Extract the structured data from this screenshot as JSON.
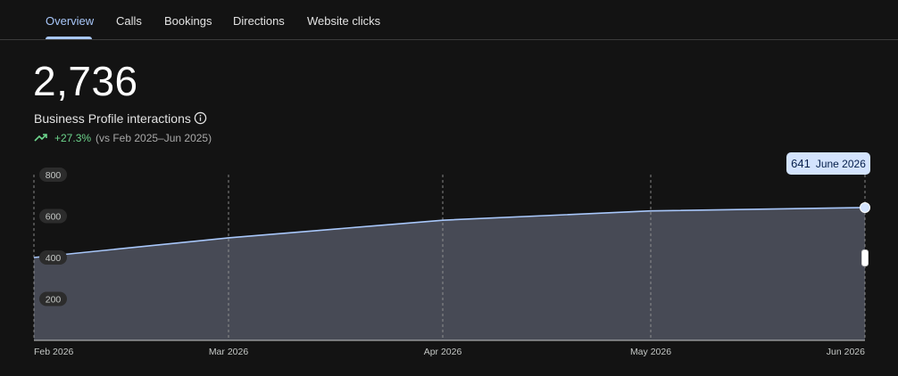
{
  "tabs": [
    {
      "label": "Overview",
      "active": true
    },
    {
      "label": "Calls",
      "active": false
    },
    {
      "label": "Bookings",
      "active": false
    },
    {
      "label": "Directions",
      "active": false
    },
    {
      "label": "Website clicks",
      "active": false
    }
  ],
  "summary": {
    "total": "2,736",
    "label": "Business Profile interactions",
    "change": "+27.3%",
    "comparison": "(vs Feb 2025–Jun 2025)"
  },
  "tooltip": {
    "value": "641",
    "period": "June 2026"
  },
  "colors": {
    "accent": "#a8c7fa",
    "positive": "#6dd58c",
    "area_fill": "#474a55",
    "line": "#a8c7fa"
  },
  "chart_data": {
    "type": "area",
    "x": [
      "Feb 2026",
      "Mar 2026",
      "Apr 2026",
      "May 2026",
      "Jun 2026"
    ],
    "series": [
      {
        "values": [
          400,
          495,
          580,
          625,
          641
        ]
      }
    ],
    "yticks": [
      800,
      600,
      400,
      200
    ],
    "ylim": [
      0,
      820
    ],
    "grid": "vertical dashed at each month",
    "highlighted_point": {
      "x": "Jun 2026",
      "y": 641
    }
  }
}
